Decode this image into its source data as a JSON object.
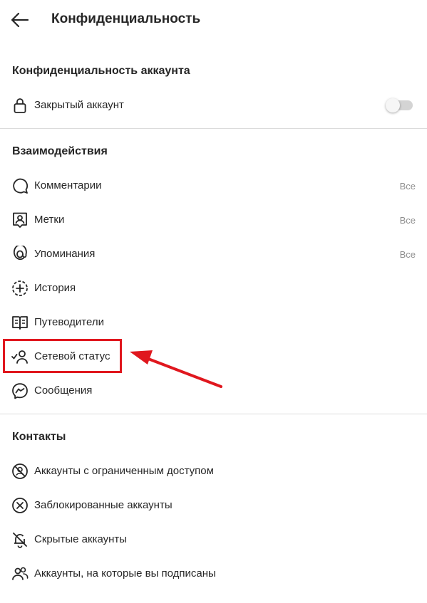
{
  "header": {
    "title": "Конфиденциальность"
  },
  "account_privacy": {
    "title": "Конфиденциальность аккаунта",
    "private_account": {
      "label": "Закрытый аккаунт",
      "toggle_on": false
    }
  },
  "interactions": {
    "title": "Взаимодействия",
    "items": [
      {
        "label": "Комментарии",
        "value": "Все",
        "icon": "comment-icon"
      },
      {
        "label": "Метки",
        "value": "Все",
        "icon": "tag-person-icon"
      },
      {
        "label": "Упоминания",
        "value": "Все",
        "icon": "mention-icon"
      },
      {
        "label": "История",
        "value": "",
        "icon": "story-add-icon"
      },
      {
        "label": "Путеводители",
        "value": "",
        "icon": "guide-book-icon"
      },
      {
        "label": "Сетевой статус",
        "value": "",
        "icon": "activity-status-icon"
      },
      {
        "label": "Сообщения",
        "value": "",
        "icon": "messenger-icon"
      }
    ]
  },
  "contacts": {
    "title": "Контакты",
    "items": [
      {
        "label": "Аккаунты с ограниченным доступом",
        "icon": "restricted-icon"
      },
      {
        "label": "Заблокированные аккаунты",
        "icon": "blocked-icon"
      },
      {
        "label": "Скрытые аккаунты",
        "icon": "muted-bell-icon"
      },
      {
        "label": "Аккаунты, на которые вы подписаны",
        "icon": "following-icon"
      }
    ]
  },
  "colors": {
    "text": "#262626",
    "secondary_text": "#8e8e8e",
    "divider": "#dbdbdb",
    "annotation_red": "#e0171e"
  }
}
